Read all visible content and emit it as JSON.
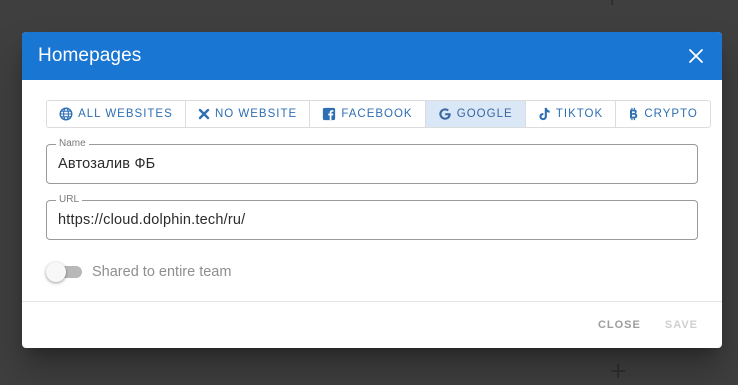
{
  "dialog": {
    "title": "Homepages",
    "close_icon": "close-icon"
  },
  "tabs": [
    {
      "label": "All websites",
      "icon": "globe-icon",
      "active": false
    },
    {
      "label": "No website",
      "icon": "cross-icon",
      "active": false
    },
    {
      "label": "Facebook",
      "icon": "facebook-icon",
      "active": false
    },
    {
      "label": "Google",
      "icon": "google-icon",
      "active": true
    },
    {
      "label": "TikTok",
      "icon": "tiktok-icon",
      "active": false
    },
    {
      "label": "Crypto",
      "icon": "bitcoin-icon",
      "active": false
    }
  ],
  "fields": {
    "name": {
      "label": "Name",
      "value": "Автозалив ФБ"
    },
    "url": {
      "label": "URL",
      "value": "https://cloud.dolphin.tech/ru/"
    }
  },
  "toggle": {
    "label": "Shared to entire team",
    "checked": false
  },
  "actions": {
    "close_label": "Close",
    "save_label": "Save"
  },
  "colors": {
    "header": "#1976d2",
    "tab_text": "#2e6fb4",
    "tab_active_bg": "#d9e7f6",
    "backdrop": "#3f3f3f"
  }
}
